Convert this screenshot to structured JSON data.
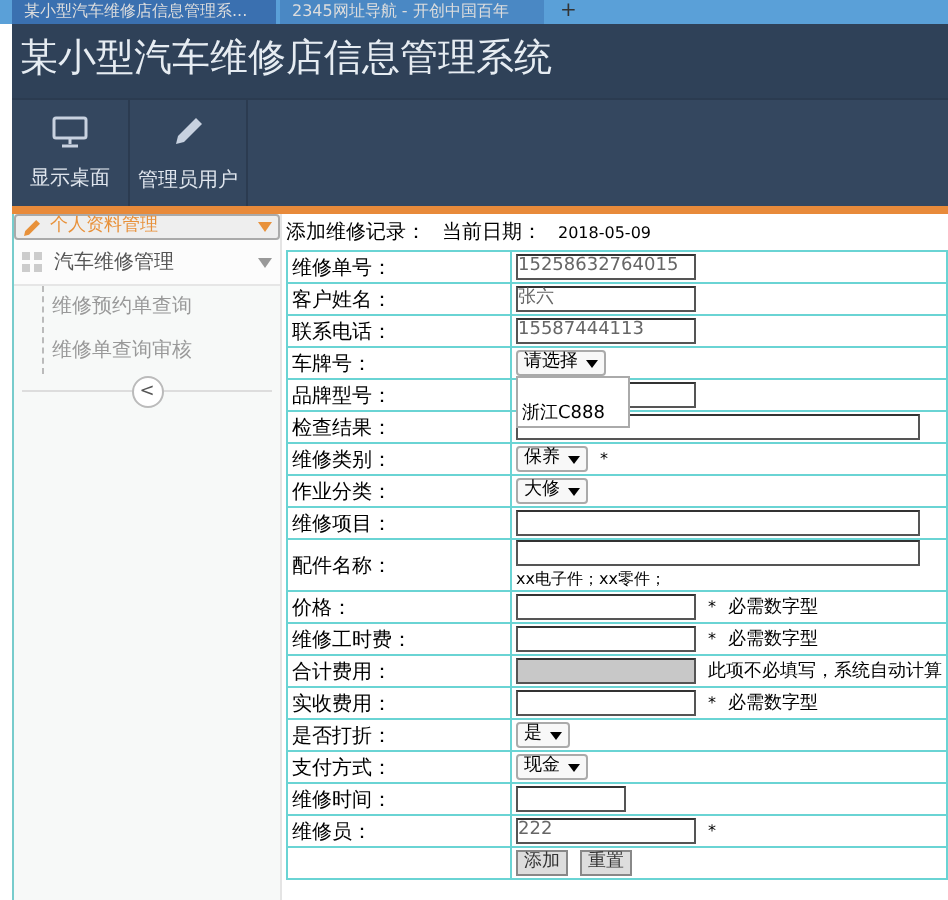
{
  "browser_tabs": [
    {
      "title": "某小型汽车维修店信息管理系...",
      "selected": true
    },
    {
      "title": "2345网址导航 - 开创中国百年",
      "selected": false
    }
  ],
  "new_tab": "+",
  "header": {
    "title": "某小型汽车维修店信息管理系统",
    "toolbar": [
      {
        "label": "显示桌面"
      },
      {
        "label": "管理员用户"
      }
    ]
  },
  "sidebar": {
    "items": [
      {
        "label": "个人资料管理",
        "selected": true
      },
      {
        "label": "汽车维修管理",
        "selected": false,
        "children": [
          {
            "label": "维修预约单查询"
          },
          {
            "label": "维修单查询审核"
          }
        ]
      }
    ],
    "collapse": "<"
  },
  "form": {
    "heading": "添加维修记录：",
    "date_label": "当前日期：",
    "date": "2018-05-09",
    "rows": [
      {
        "label": "维修单号：",
        "kind": "text",
        "value": "15258632764015"
      },
      {
        "label": "客户姓名：",
        "kind": "text",
        "value": "张六"
      },
      {
        "label": "联系电话：",
        "kind": "text",
        "value": "15587444113"
      },
      {
        "label": "车牌号：",
        "kind": "select",
        "value": "请选择",
        "open": true,
        "options": [
          "浙江C888"
        ]
      },
      {
        "label": "品牌型号：",
        "kind": "text"
      },
      {
        "label": "检查结果：",
        "kind": "long"
      },
      {
        "label": "维修类别：",
        "kind": "select",
        "value": "保养",
        "mark": "*"
      },
      {
        "label": "作业分类：",
        "kind": "select",
        "value": "大修"
      },
      {
        "label": "维修项目：",
        "kind": "long"
      },
      {
        "label": "配件名称：",
        "kind": "long",
        "hint": "xx电子件；xx零件；"
      },
      {
        "label": "价格：",
        "kind": "text",
        "mark": "*",
        "note": "必需数字型"
      },
      {
        "label": "维修工时费：",
        "kind": "text",
        "mark": "*",
        "note": "必需数字型"
      },
      {
        "label": "合计费用：",
        "kind": "disabled",
        "note": "此项不必填写，系统自动计算"
      },
      {
        "label": "实收费用：",
        "kind": "text",
        "mark": "*",
        "note": "必需数字型"
      },
      {
        "label": "是否打折：",
        "kind": "select",
        "value": "是"
      },
      {
        "label": "支付方式：",
        "kind": "select",
        "value": "现金"
      },
      {
        "label": "维修时间：",
        "kind": "short"
      },
      {
        "label": "维修员：",
        "kind": "text",
        "value": "222",
        "mark": "*"
      }
    ],
    "buttons": [
      "添加",
      "重置"
    ]
  }
}
